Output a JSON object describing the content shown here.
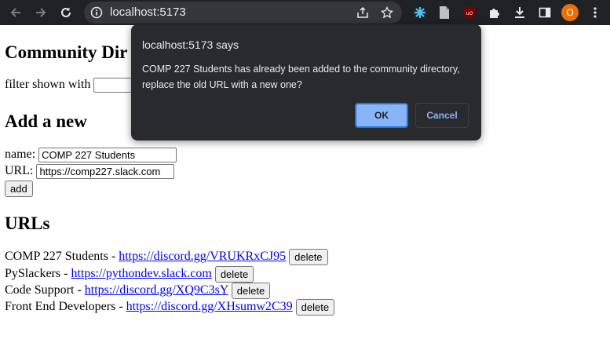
{
  "browser": {
    "url": "localhost:5173",
    "profile_initial": "O"
  },
  "page": {
    "title": "Community Dir",
    "filter_label": "filter shown with",
    "filter_value": "",
    "add_heading": "Add a new",
    "name_label": "name:",
    "name_value": "COMP 227 Students",
    "url_label": "URL:",
    "url_value": "https://comp227.slack.com",
    "add_button": "add",
    "urls_heading": "URLs",
    "entries": [
      {
        "name": "COMP 227 Students",
        "sep": " - ",
        "url": "https://discord.gg/VRUKRxCJ95",
        "delete": "delete"
      },
      {
        "name": "PySlackers",
        "sep": " - ",
        "url": "https://pythondev.slack.com",
        "delete": "delete"
      },
      {
        "name": "Code Support",
        "sep": " - ",
        "url": "https://discord.gg/XQ9C3sY",
        "delete": "delete"
      },
      {
        "name": "Front End Developers",
        "sep": " - ",
        "url": "https://discord.gg/XHsumw2C39",
        "delete": "delete"
      }
    ]
  },
  "dialog": {
    "title": "localhost:5173 says",
    "message": "COMP 227 Students has already been added to the community directory, replace the old URL with a new one?",
    "ok_label": "OK",
    "cancel_label": "Cancel"
  }
}
